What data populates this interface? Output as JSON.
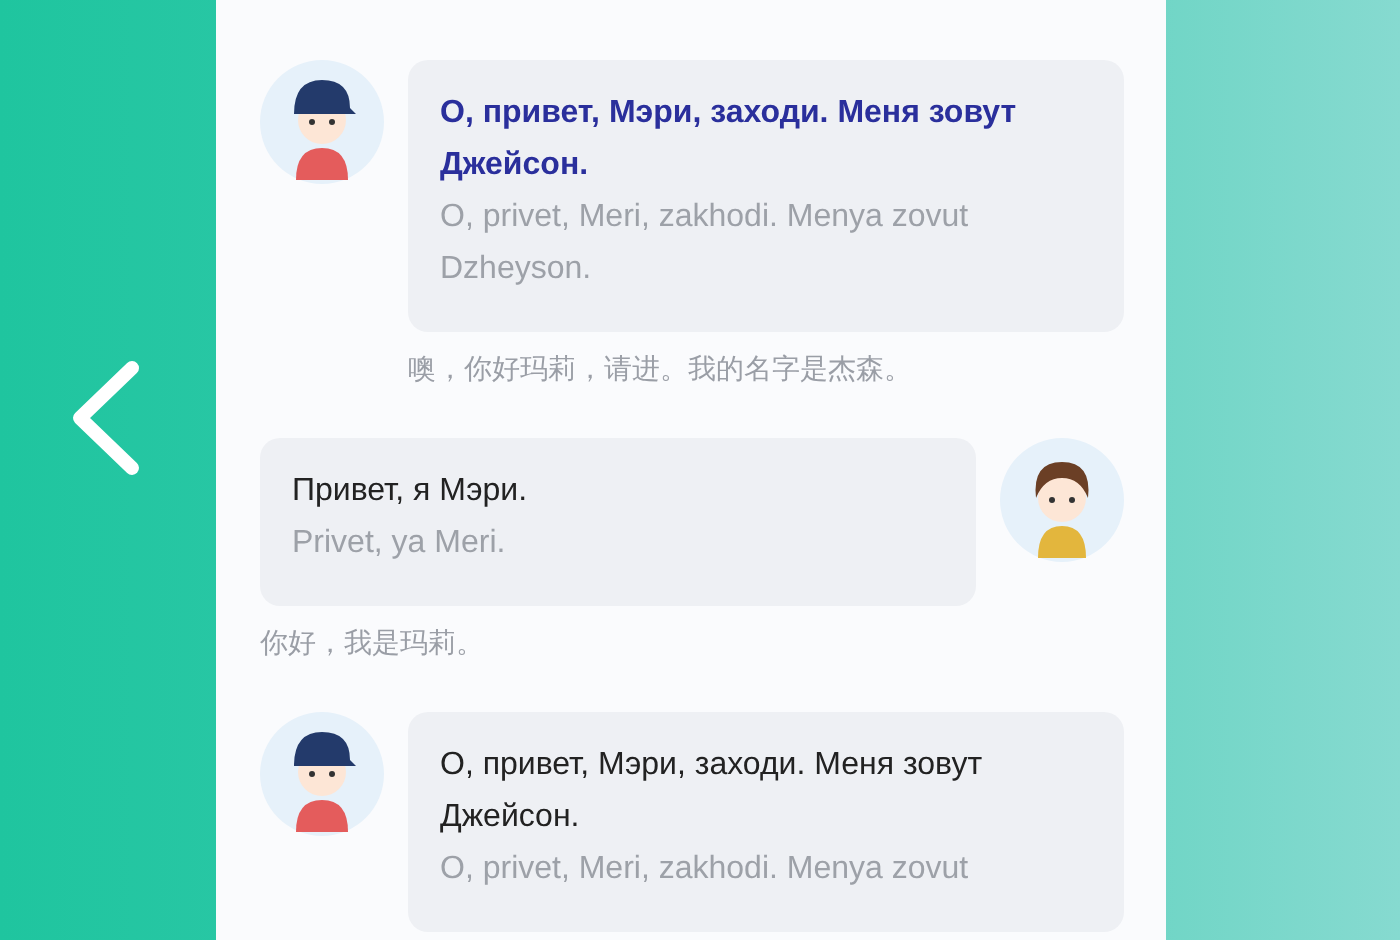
{
  "messages": [
    {
      "kind": "incoming",
      "highlighted": true,
      "text": "О, привет, Мэри, заходи. Меня зовут Джейсон.",
      "transliteration": "O, privet, Meri, zakhodi. Menya zovut Dzheyson.",
      "translation": "噢，你好玛莉，请进。我的名字是杰森。"
    },
    {
      "kind": "outgoing",
      "highlighted": false,
      "text": "Привет, я Мэри.",
      "transliteration": "Privet, ya Meri.",
      "translation": "你好，我是玛莉。"
    },
    {
      "kind": "incoming",
      "highlighted": false,
      "text": "О, привет, Мэри, заходи. Меня зовут Джейсон.",
      "transliteration": "O, privet, Meri, zakhodi. Menya zovut"
    }
  ]
}
